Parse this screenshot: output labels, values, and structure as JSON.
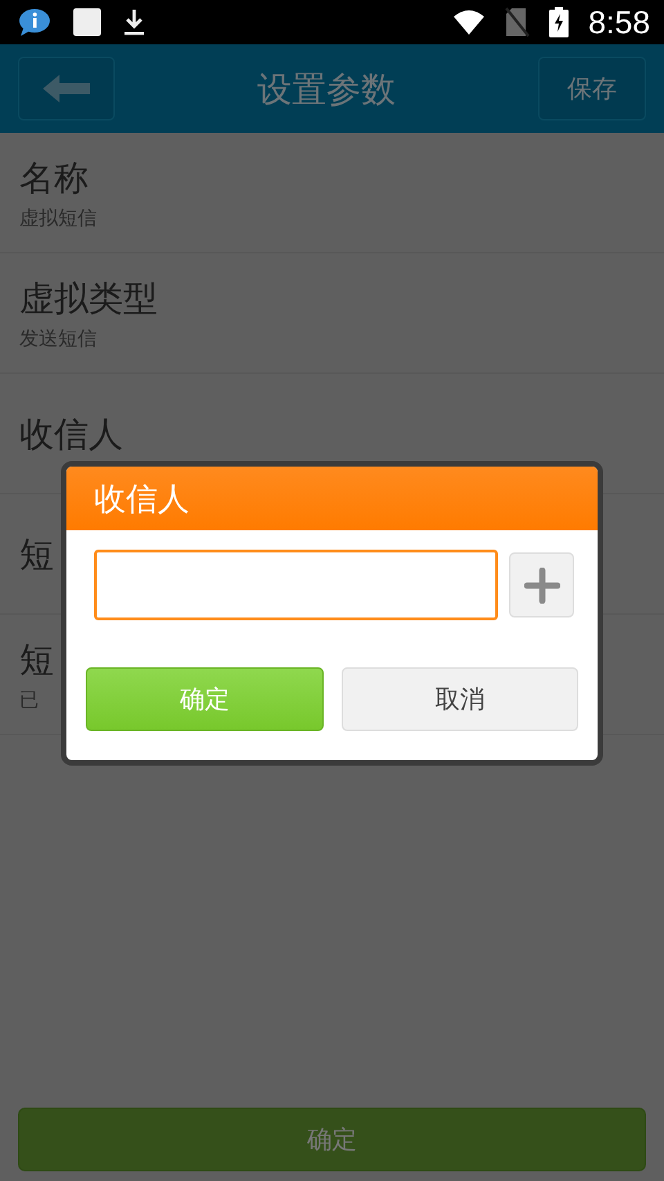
{
  "status_bar": {
    "time": "8:58"
  },
  "header": {
    "title": "设置参数",
    "save": "保存"
  },
  "rows": [
    {
      "title": "名称",
      "subtitle": "虚拟短信"
    },
    {
      "title": "虚拟类型",
      "subtitle": "发送短信"
    },
    {
      "title": "收信人"
    },
    {
      "title": "短"
    },
    {
      "title": "短",
      "subtitle": "已"
    }
  ],
  "dialog": {
    "title": "收信人",
    "confirm": "确定",
    "cancel": "取消"
  },
  "bottom_button": "确定"
}
